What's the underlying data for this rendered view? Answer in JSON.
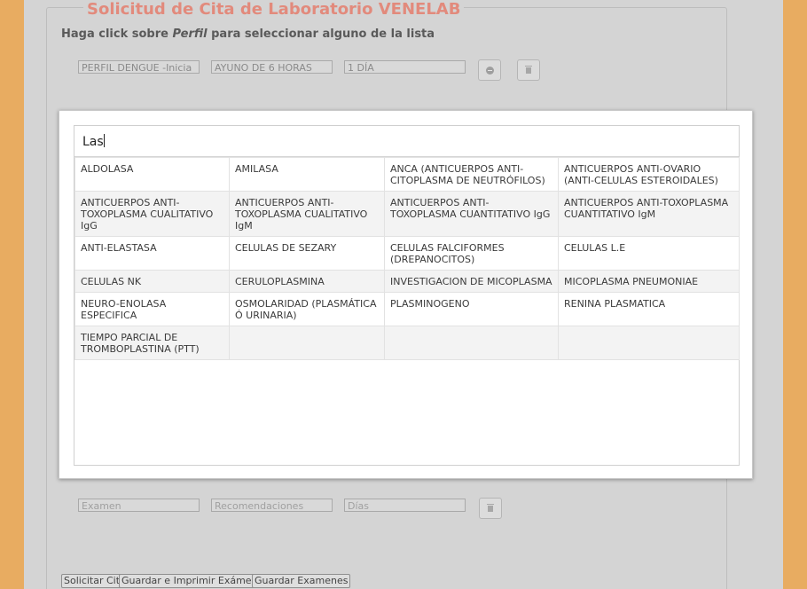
{
  "form": {
    "legend": "Solicitud de Cita de Laboratorio VENELAB",
    "instructions_pre": "Haga click sobre ",
    "instructions_em": "Perfil",
    "instructions_post": " para seleccionar alguno de la lista",
    "profile_row": {
      "perfil_value": "PERFIL DENGUE -Inicia",
      "recomendacion_value": "AYUNO DE 6 HORAS",
      "dias_value": "1 DÍA"
    },
    "exam_row": {
      "examen_placeholder": "Examen",
      "recomendaciones_placeholder": "Recomendaciones",
      "dias_placeholder": "Días"
    },
    "buttons": {
      "solicitar": "Solicitar Cita",
      "guardar_imprimir": "Guardar e Imprimir Exámenes",
      "guardar": "Guardar Examenes"
    }
  },
  "picker": {
    "search_value": "Las",
    "rows": [
      [
        "ALDOLASA",
        "AMILASA",
        "ANCA (ANTICUERPOS ANTI-CITOPLASMA DE NEUTRÓFILOS)",
        "ANTICUERPOS ANTI-OVARIO (ANTI-CELULAS ESTEROIDALES)"
      ],
      [
        "ANTICUERPOS ANTI-TOXOPLASMA CUALITATIVO IgG",
        "ANTICUERPOS ANTI-TOXOPLASMA CUALITATIVO IgM",
        "ANTICUERPOS ANTI-TOXOPLASMA CUANTITATIVO IgG",
        "ANTICUERPOS ANTI-TOXOPLASMA CUANTITATIVO IgM"
      ],
      [
        "ANTI-ELASTASA",
        "CELULAS DE SEZARY",
        "CELULAS FALCIFORMES (DREPANOCITOS)",
        "CELULAS L.E"
      ],
      [
        "CELULAS NK",
        "CERULOPLASMINA",
        "INVESTIGACION DE MICOPLASMA",
        "MICOPLASMA PNEUMONIAE"
      ],
      [
        "NEURO-ENOLASA ESPECIFICA",
        "OSMOLARIDAD (PLASMÁTICA Ó URINARIA)",
        "PLASMINOGENO",
        "RENINA PLASMATICA"
      ],
      [
        "TIEMPO PARCIAL DE TROMBOPLASTINA (PTT)",
        "",
        "",
        ""
      ]
    ]
  }
}
